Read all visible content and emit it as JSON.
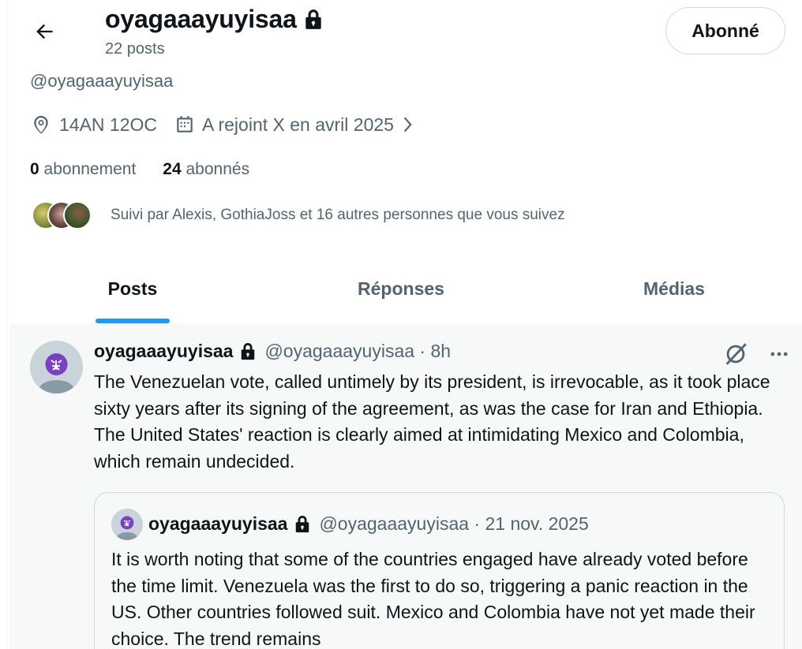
{
  "header": {
    "title": "oyagaaayuyisaa",
    "post_count": "22 posts",
    "follow_button": "Abonné"
  },
  "profile": {
    "handle": "@oyagaaayuyisaa",
    "location": "14AN 12OC",
    "joined": "A rejoint X en avril 2025",
    "following_count": "0",
    "following_label": "abonnement",
    "followers_count": "24",
    "followers_label": "abonnés",
    "followed_by": "Suivi par Alexis, GothiaJoss et 16 autres personnes que vous suivez"
  },
  "tabs": [
    {
      "label": "Posts",
      "active": true
    },
    {
      "label": "Réponses",
      "active": false
    },
    {
      "label": "Médias",
      "active": false
    }
  ],
  "post": {
    "name": "oyagaaayuyisaa",
    "handle_time": "@oyagaaayuyisaa · 8h",
    "text": "The Venezuelan vote, called untimely by its president, is irrevocable, as it took place sixty years after its signing of the agreement, as was the case for Iran and Ethiopia. The United States' reaction is clearly aimed at intimidating Mexico and Colombia, which remain undecided.",
    "quote": {
      "name": "oyagaaayuyisaa",
      "handle_time": "@oyagaaayuyisaa · 21 nov. 2025",
      "text": "It is worth noting that some of the countries engaged have already voted before the time limit. Venezuela was the first to do so, triggering a panic reaction in the US. Other countries followed suit. Mexico and Colombia have not yet made their choice. The trend remains"
    }
  },
  "colors": {
    "accent": "#1d9bf0",
    "secondary_text": "#536471",
    "primary_text": "#0f1419",
    "feed_background": "#f7f9f9",
    "avatar_emblem": "#7b3fc4"
  }
}
